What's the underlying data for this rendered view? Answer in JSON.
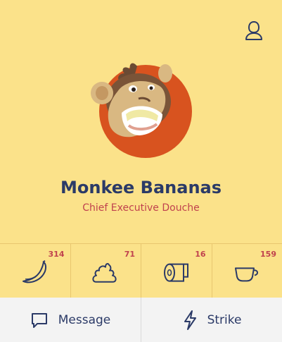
{
  "profile": {
    "name": "Monkee Bananas",
    "title": "Chief Executive Douche"
  },
  "stats": [
    {
      "icon": "banana-icon",
      "count": "314"
    },
    {
      "icon": "poop-icon",
      "count": "71"
    },
    {
      "icon": "toilet-paper-icon",
      "count": "16"
    },
    {
      "icon": "coffee-cup-icon",
      "count": "159"
    }
  ],
  "actions": {
    "message_label": "Message",
    "strike_label": "Strike"
  },
  "colors": {
    "background": "#fbe28a",
    "primary": "#2b3a67",
    "accent": "#c0424e",
    "avatar_ring": "#d8531f",
    "bar": "#f3f3f3"
  }
}
